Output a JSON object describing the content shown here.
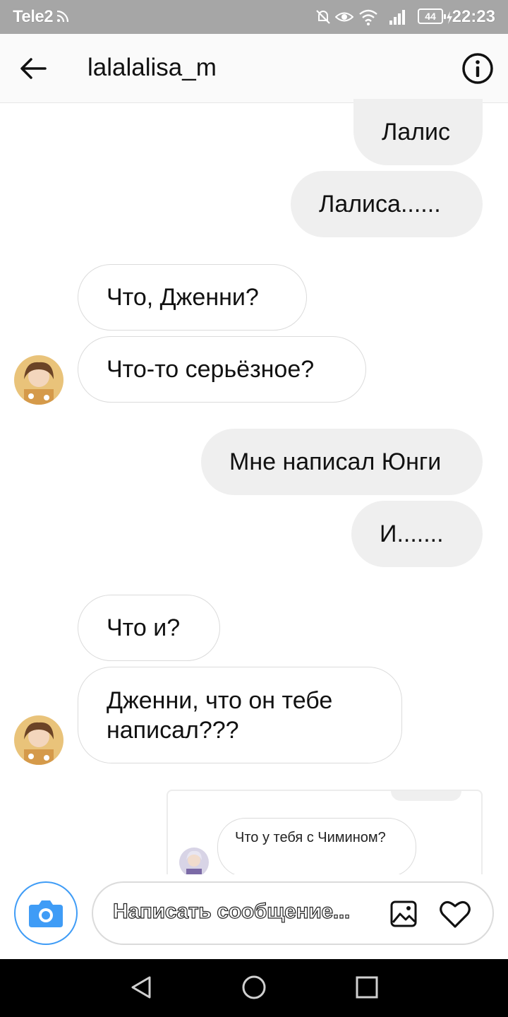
{
  "status_bar": {
    "carrier": "Tele2",
    "battery": "44",
    "time": "22:23"
  },
  "header": {
    "username": "lalalalisa_m"
  },
  "messages": [
    {
      "side": "out",
      "text": "Лалис"
    },
    {
      "side": "out",
      "text": "Лалиса......"
    },
    {
      "side": "in",
      "text": "Что, Дженни?"
    },
    {
      "side": "in",
      "text": "Что-то серьёзное?"
    },
    {
      "side": "out",
      "text": "Мне написал Юнги"
    },
    {
      "side": "out",
      "text": "И......."
    },
    {
      "side": "in",
      "text": "Что и?"
    },
    {
      "side": "in",
      "text": "Дженни, что он тебе написал???"
    }
  ],
  "shared_post": {
    "text": "Что у тебя с Чимином?"
  },
  "composer": {
    "placeholder": "Написать сообщение..."
  },
  "colors": {
    "accent": "#3f9cf6",
    "outgoing_bubble": "#efefef",
    "status_bar": "#a6a6a6"
  }
}
